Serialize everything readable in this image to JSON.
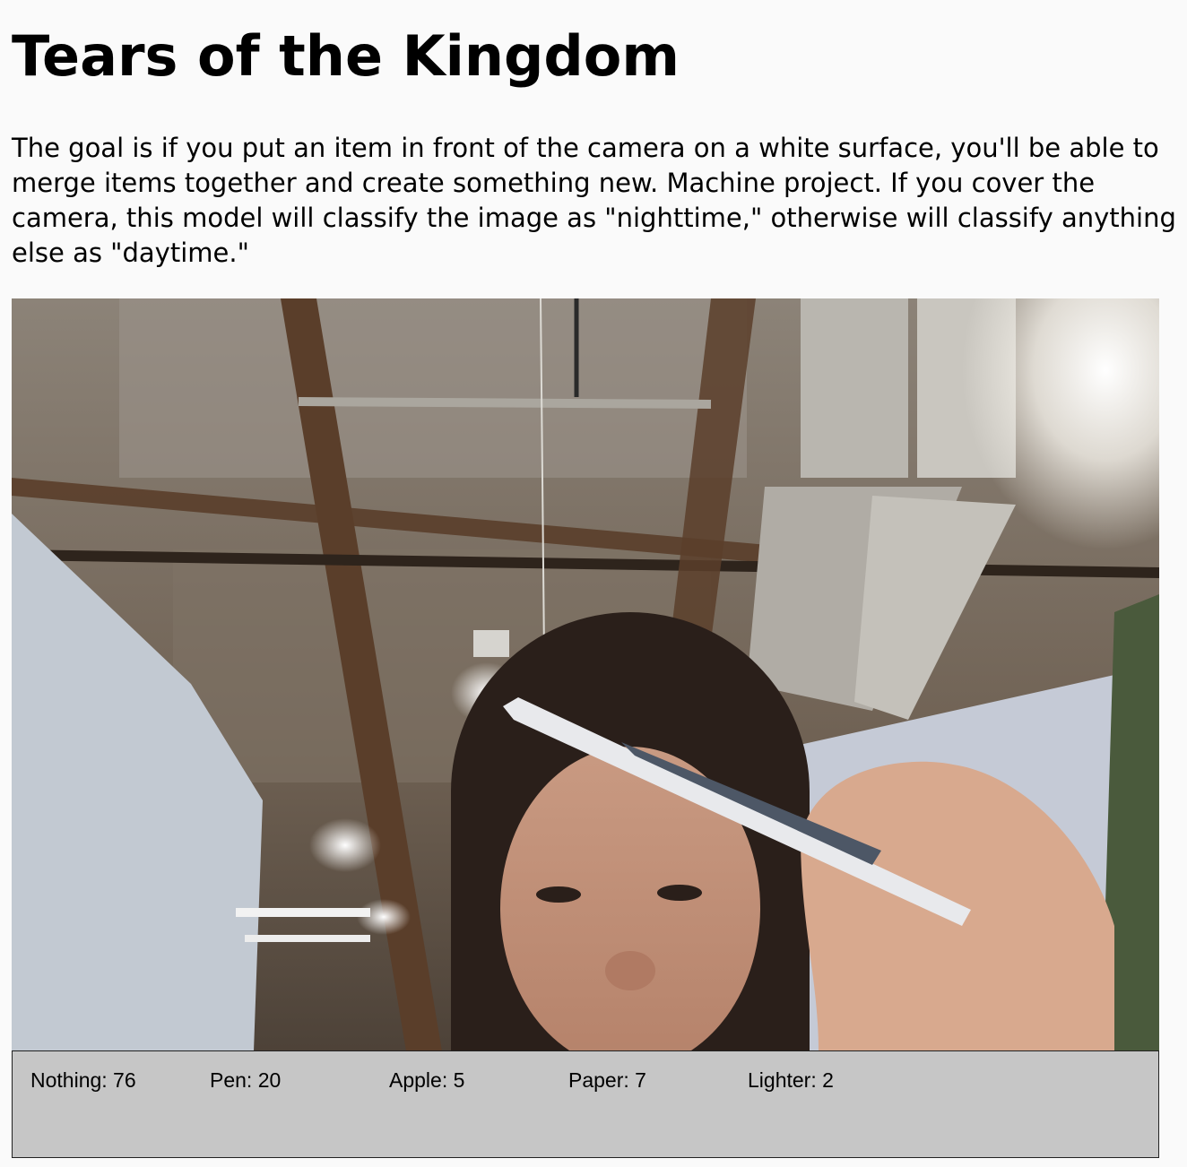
{
  "page": {
    "title": "Tears of the Kingdom",
    "description": "The goal is if you put an item in front of the camera on a white surface, you'll be able to merge items together and create something new. Machine project. If you cover the camera, this model will classify the image as \"nighttime,\" otherwise will classify anything else as \"daytime.\""
  },
  "video": {
    "icon": "webcam-feed"
  },
  "predictions": [
    {
      "label": "Nothing",
      "value": 76,
      "text": "Nothing: 76"
    },
    {
      "label": "Pen",
      "value": 20,
      "text": "Pen: 20"
    },
    {
      "label": "Apple",
      "value": 5,
      "text": "Apple: 5"
    },
    {
      "label": "Paper",
      "value": 7,
      "text": "Paper: 7"
    },
    {
      "label": "Lighter",
      "value": 2,
      "text": "Lighter: 2"
    }
  ],
  "colors": {
    "background": "#fafafa",
    "prediction_panel": "#c6c6c6",
    "text": "#000000"
  }
}
